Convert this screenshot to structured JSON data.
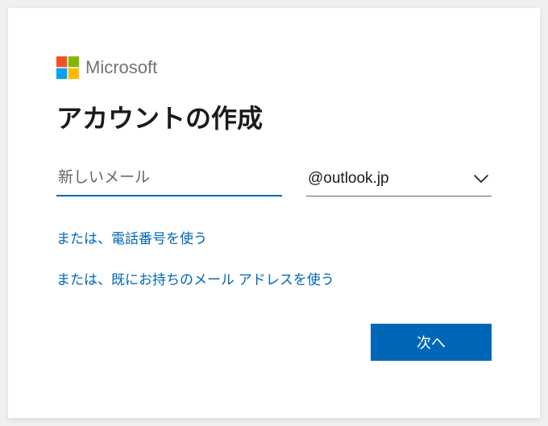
{
  "brand": {
    "name": "Microsoft"
  },
  "title": "アカウントの作成",
  "email": {
    "placeholder": "新しいメール",
    "value": ""
  },
  "domain": {
    "selected": "@outlook.jp"
  },
  "links": {
    "use_phone": "または、電話番号を使う",
    "use_existing": "または、既にお持ちのメール アドレスを使う"
  },
  "buttons": {
    "next": "次へ"
  },
  "colors": {
    "primary": "#0067b8"
  }
}
